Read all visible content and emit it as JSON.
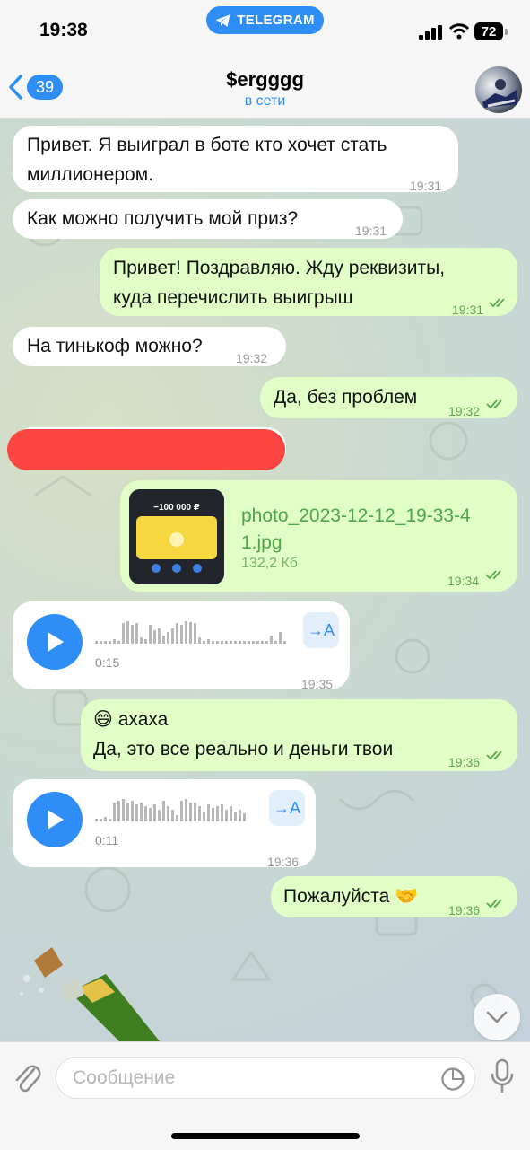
{
  "status": {
    "time": "19:38",
    "app_pill": "TELEGRAM",
    "battery": "72"
  },
  "header": {
    "back_count": "39",
    "title": "$ergggg",
    "subtitle": "в сети"
  },
  "messages": [
    {
      "dir": "in",
      "text_line1": "Привет. Я выиграл в боте кто хочет стать",
      "text_line2": "миллионером.",
      "time": "19:31"
    },
    {
      "dir": "in",
      "text": "Как можно получить мой приз?",
      "time": "19:31"
    },
    {
      "dir": "out",
      "text_line1": "Привет! Поздравляю. Жду реквизиты,",
      "text_line2": "куда перечислить выигрыш",
      "time": "19:31"
    },
    {
      "dir": "in",
      "text": "На тинькоф можно?",
      "time": "19:32"
    },
    {
      "dir": "out",
      "text": "Да, без проблем",
      "time": "19:32"
    },
    {
      "dir": "in",
      "redacted": true
    },
    {
      "dir": "out",
      "type": "file",
      "file_line1": "photo_2023-12-12_19-33-4",
      "file_line2": "1.jpg",
      "size": "132,2 Кб",
      "thumb_amount": "−100 000 ₽",
      "time": "19:34"
    },
    {
      "dir": "in",
      "type": "voice",
      "duration": "0:15",
      "transcribe": "→A",
      "time": "19:35"
    },
    {
      "dir": "out",
      "emoji": "😄",
      "text_line1": "ахаха",
      "text_line2": "Да, это все реально и деньги твои",
      "time": "19:36"
    },
    {
      "dir": "in",
      "type": "voice",
      "duration": "0:11",
      "transcribe": "→A",
      "time": "19:36"
    },
    {
      "dir": "out",
      "text": "Пожалуйста",
      "emoji": "🤝",
      "time": "19:36"
    }
  ],
  "composer": {
    "placeholder": "Сообщение"
  },
  "icons": {
    "back": "chevron-left-icon",
    "attach": "paperclip-icon",
    "sticker": "sticker-icon",
    "mic": "microphone-icon",
    "scroll": "chevron-down-icon",
    "read": "double-check-icon"
  },
  "colors": {
    "accent": "#2f8ef5",
    "outgoing_bubble": "#e1fec6",
    "incoming_bubble": "#ffffff",
    "redaction": "#fb4541"
  }
}
